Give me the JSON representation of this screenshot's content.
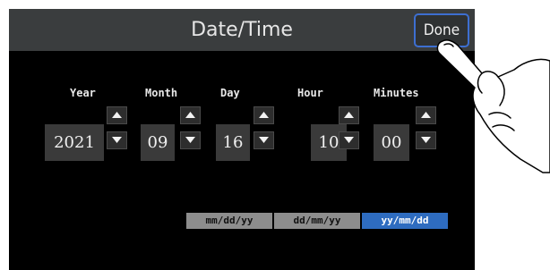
{
  "header": {
    "title": "Date/Time",
    "done_label": "Done"
  },
  "fields": [
    {
      "label": "Year",
      "value": "2021"
    },
    {
      "label": "Month",
      "value": "09"
    },
    {
      "label": "Day",
      "value": "16"
    },
    {
      "label": "Hour",
      "value": "10"
    },
    {
      "label": "Minutes",
      "value": "00"
    }
  ],
  "format_options": [
    {
      "label": "mm/dd/yy",
      "selected": false
    },
    {
      "label": "dd/mm/yy",
      "selected": false
    },
    {
      "label": "yy/mm/dd",
      "selected": true
    }
  ],
  "colors": {
    "accent": "#2e6cc0",
    "title_bar": "#3a3d3e",
    "screen_bg": "#000000"
  }
}
